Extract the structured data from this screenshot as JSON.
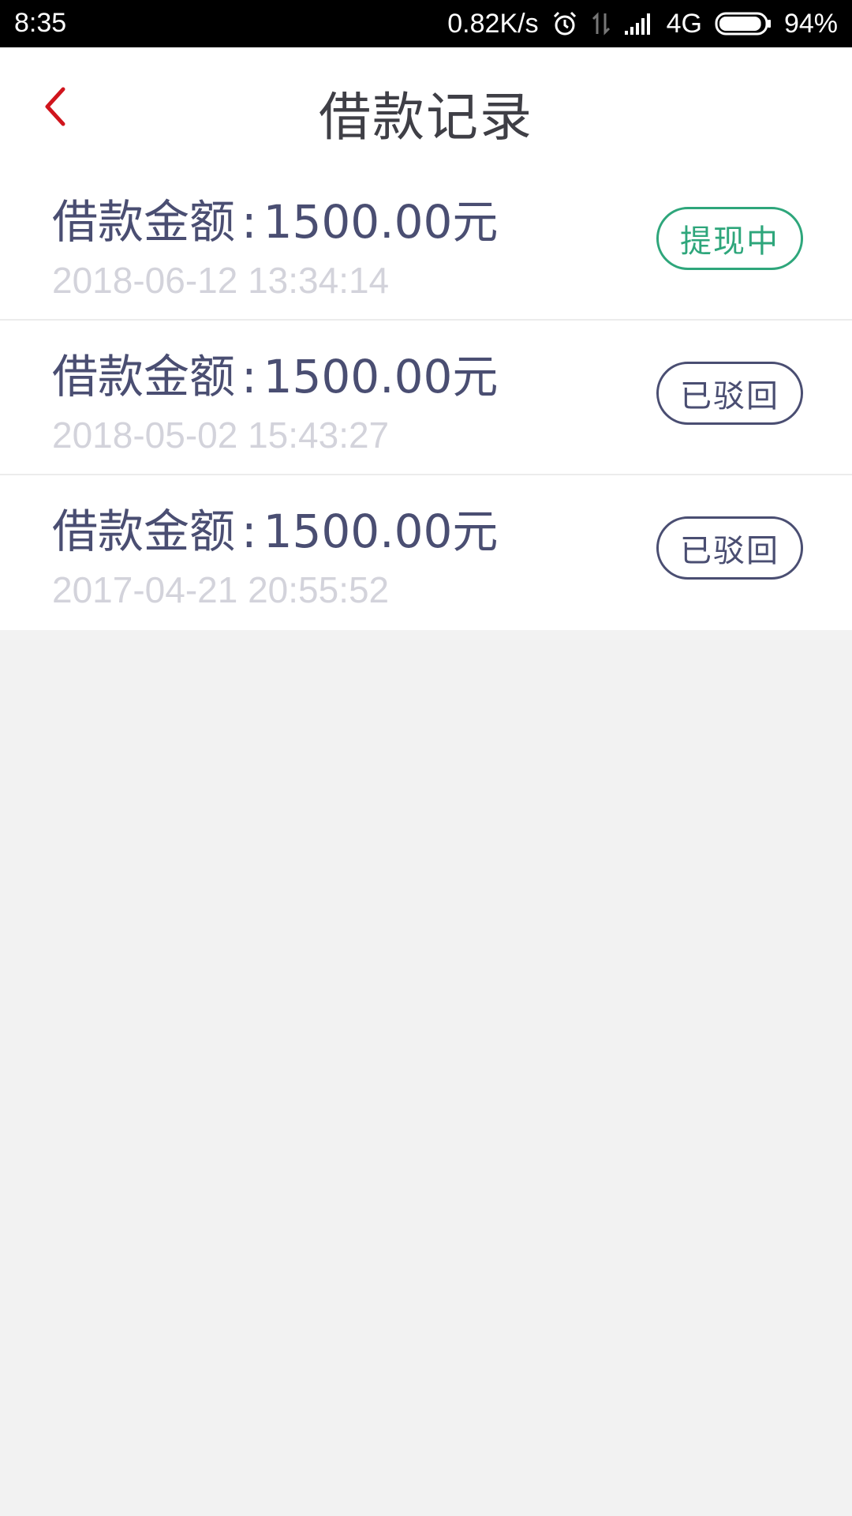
{
  "status_bar": {
    "time": "8:35",
    "net_speed": "0.82K/s",
    "network": "4G",
    "battery": "94%",
    "battery_level": 0.94
  },
  "header": {
    "title": "借款记录",
    "back_icon": "chevron-left-icon",
    "back_color": "#d0151d"
  },
  "records": [
    {
      "label": "借款金额",
      "colon": ":",
      "amount": "1500.00元",
      "date": "2018-06-12 13:34:14",
      "status": "提现中",
      "status_color": "#2ea67b"
    },
    {
      "label": "借款金额",
      "colon": ":",
      "amount": "1500.00元",
      "date": "2018-05-02 15:43:27",
      "status": "已驳回",
      "status_color": "#4a4e72"
    },
    {
      "label": "借款金额",
      "colon": ":",
      "amount": "1500.00元",
      "date": "2017-04-21 20:55:52",
      "status": "已驳回",
      "status_color": "#4a4e72"
    }
  ]
}
